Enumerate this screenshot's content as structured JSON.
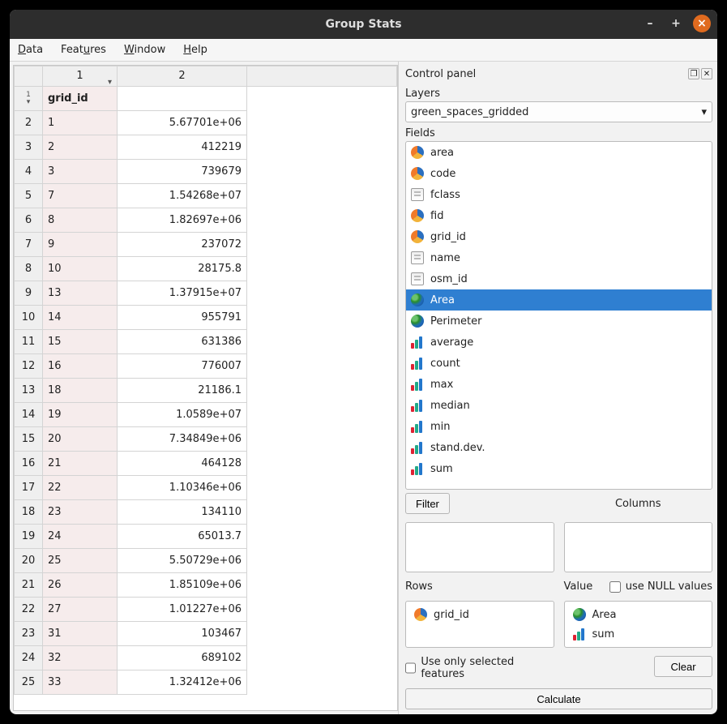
{
  "window": {
    "title": "Group Stats"
  },
  "menubar": [
    "Data",
    "Features",
    "Window",
    "Help"
  ],
  "table": {
    "col_headers": [
      "1",
      "2"
    ],
    "header_row_label": "grid_id",
    "rows": [
      {
        "n": "2",
        "c1": "1",
        "c2": "5.67701e+06"
      },
      {
        "n": "3",
        "c1": "2",
        "c2": "412219"
      },
      {
        "n": "4",
        "c1": "3",
        "c2": "739679"
      },
      {
        "n": "5",
        "c1": "7",
        "c2": "1.54268e+07"
      },
      {
        "n": "6",
        "c1": "8",
        "c2": "1.82697e+06"
      },
      {
        "n": "7",
        "c1": "9",
        "c2": "237072"
      },
      {
        "n": "8",
        "c1": "10",
        "c2": "28175.8"
      },
      {
        "n": "9",
        "c1": "13",
        "c2": "1.37915e+07"
      },
      {
        "n": "10",
        "c1": "14",
        "c2": "955791"
      },
      {
        "n": "11",
        "c1": "15",
        "c2": "631386"
      },
      {
        "n": "12",
        "c1": "16",
        "c2": "776007"
      },
      {
        "n": "13",
        "c1": "18",
        "c2": "21186.1"
      },
      {
        "n": "14",
        "c1": "19",
        "c2": "1.0589e+07"
      },
      {
        "n": "15",
        "c1": "20",
        "c2": "7.34849e+06"
      },
      {
        "n": "16",
        "c1": "21",
        "c2": "464128"
      },
      {
        "n": "17",
        "c1": "22",
        "c2": "1.10346e+06"
      },
      {
        "n": "18",
        "c1": "23",
        "c2": "134110"
      },
      {
        "n": "19",
        "c1": "24",
        "c2": "65013.7"
      },
      {
        "n": "20",
        "c1": "25",
        "c2": "5.50729e+06"
      },
      {
        "n": "21",
        "c1": "26",
        "c2": "1.85109e+06"
      },
      {
        "n": "22",
        "c1": "27",
        "c2": "1.01227e+06"
      },
      {
        "n": "23",
        "c1": "31",
        "c2": "103467"
      },
      {
        "n": "24",
        "c1": "32",
        "c2": "689102"
      },
      {
        "n": "25",
        "c1": "33",
        "c2": "1.32412e+06"
      }
    ]
  },
  "panel": {
    "title": "Control panel",
    "layers_label": "Layers",
    "layers_value": "green_spaces_gridded",
    "fields_label": "Fields",
    "fields": [
      {
        "icon": "pie",
        "label": "area"
      },
      {
        "icon": "pie",
        "label": "code"
      },
      {
        "icon": "doc",
        "label": "fclass"
      },
      {
        "icon": "pie",
        "label": "fid"
      },
      {
        "icon": "pie",
        "label": "grid_id"
      },
      {
        "icon": "doc",
        "label": "name"
      },
      {
        "icon": "doc",
        "label": "osm_id"
      },
      {
        "icon": "globe",
        "label": "Area",
        "selected": true
      },
      {
        "icon": "globe",
        "label": "Perimeter"
      },
      {
        "icon": "bars",
        "label": "average"
      },
      {
        "icon": "bars",
        "label": "count"
      },
      {
        "icon": "bars",
        "label": "max"
      },
      {
        "icon": "bars",
        "label": "median"
      },
      {
        "icon": "bars",
        "label": "min"
      },
      {
        "icon": "bars",
        "label": "stand.dev."
      },
      {
        "icon": "bars",
        "label": "sum"
      }
    ],
    "filter_label": "Filter",
    "columns_label": "Columns",
    "rows_label": "Rows",
    "value_label": "Value",
    "use_null_label": "use NULL values",
    "rows_items": [
      {
        "icon": "pie",
        "label": "grid_id"
      }
    ],
    "value_items": [
      {
        "icon": "globe",
        "label": "Area"
      },
      {
        "icon": "bars",
        "label": "sum"
      }
    ],
    "use_selected_label": "Use only selected features",
    "clear_label": "Clear",
    "calculate_label": "Calculate"
  }
}
